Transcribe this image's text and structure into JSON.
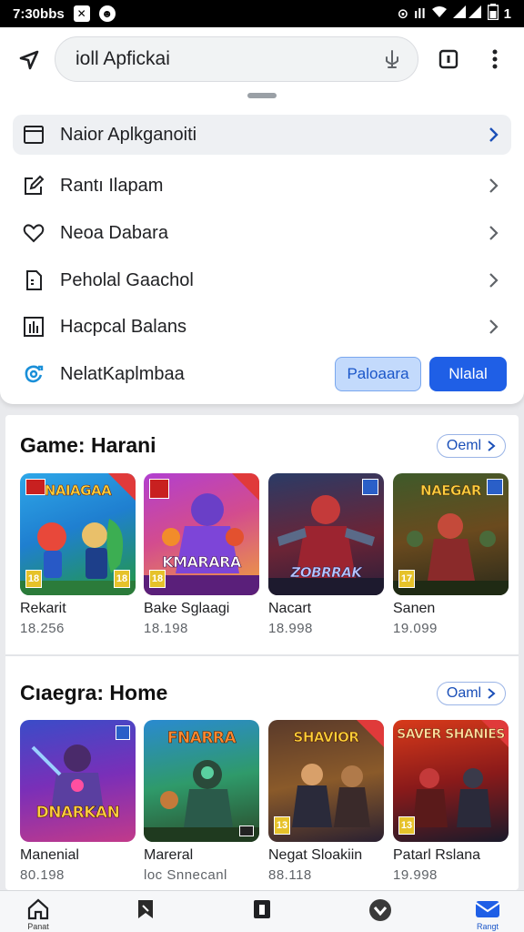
{
  "status_bar": {
    "time": "7:30",
    "carrier_text": "bbs",
    "battery": "1"
  },
  "toolbar": {
    "search_text": "ioll Apfickai"
  },
  "menu": {
    "items": [
      {
        "label": "Naior Aplkganoiti",
        "icon": "browser-window-icon"
      },
      {
        "label": "Rantı Ilapam",
        "icon": "edit-icon"
      },
      {
        "label": "Neoa Dabara",
        "icon": "heart-icon"
      },
      {
        "label": "Peholal Gaachol",
        "icon": "document-icon"
      },
      {
        "label": "Hacpcal Balans",
        "icon": "bar-chart-icon"
      },
      {
        "label": "NelatKaplmbaa",
        "icon": "sync-icon"
      }
    ],
    "secondary_button": "Paloaara",
    "primary_button": "Nlalal"
  },
  "sections": [
    {
      "title": "Game: Harani",
      "open_label": "Oeml",
      "cards": [
        {
          "thumb_title": "NAIAGAA",
          "name": "Rekarit",
          "size": "18.256",
          "rating": "18"
        },
        {
          "thumb_title": "KMARARA",
          "name": "Bake Sglaagi",
          "size": "18.198",
          "rating": "18"
        },
        {
          "thumb_title": "ZOBRRAK",
          "name": "Nacart",
          "size": "18.998",
          "rating": ""
        },
        {
          "thumb_title": "NAEGAR",
          "name": "Sanen",
          "size": "19.099",
          "rating": "17"
        }
      ]
    },
    {
      "title": "Cıaegra: Home",
      "open_label": "Oaml",
      "cards": [
        {
          "thumb_title": "DNARKAN",
          "name": "Manenial",
          "size": "80.198",
          "rating": ""
        },
        {
          "thumb_title": "FNARRA",
          "name": "Mareral",
          "size": "loc Snnecanl",
          "rating": ""
        },
        {
          "thumb_title": "SHAVIOR",
          "name": "Negat Sloakiin",
          "size": "88.118",
          "rating": "13"
        },
        {
          "thumb_title": "SAVER SHANIES",
          "name": "Patarl Rslana",
          "size": "19.998",
          "rating": "13"
        }
      ]
    }
  ],
  "bottom_nav": [
    {
      "label": "Panat",
      "icon": "home-icon"
    },
    {
      "label": "",
      "icon": "bookmark-icon"
    },
    {
      "label": "",
      "icon": "tabs-icon"
    },
    {
      "label": "",
      "icon": "download-icon"
    },
    {
      "label": "Rangt",
      "icon": "mail-icon"
    }
  ]
}
